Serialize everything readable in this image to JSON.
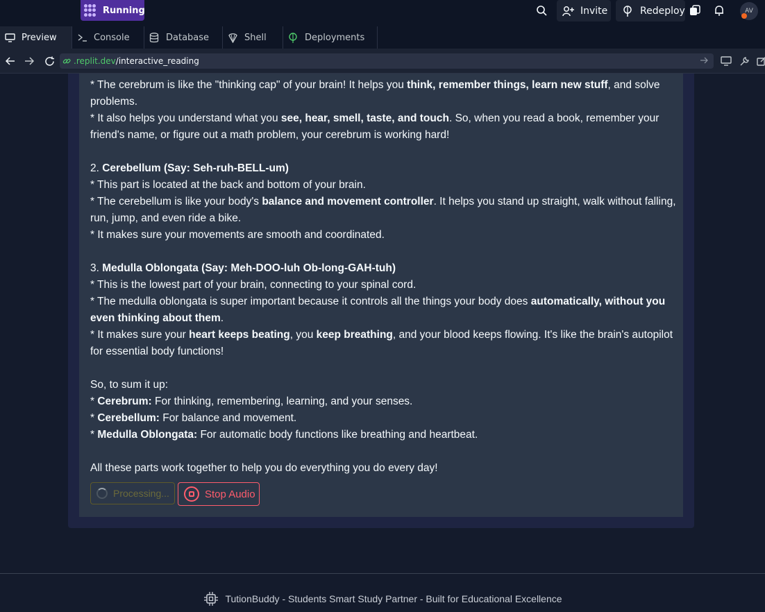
{
  "topbar": {
    "status_label": "Running",
    "invite_label": "Invite",
    "redeploy_label": "Redeploy",
    "avatar_initials": "AV"
  },
  "tabs": [
    {
      "label": "Preview",
      "icon": "monitor-icon"
    },
    {
      "label": "Console",
      "icon": "terminal-icon"
    },
    {
      "label": "Database",
      "icon": "database-icon"
    },
    {
      "label": "Shell",
      "icon": "shell-icon"
    },
    {
      "label": "Deployments",
      "icon": "deployments-icon"
    }
  ],
  "addressbar": {
    "host": ".replit.dev",
    "path": "/interactive_reading"
  },
  "article": {
    "cerebrum_1_pre": "* The cerebrum is like the \"thinking cap\" of your brain! It helps you ",
    "cerebrum_1_b": "think, remember things, learn new stuff",
    "cerebrum_1_post": ", and solve problems.",
    "cerebrum_2_pre": "* It also helps you understand what you ",
    "cerebrum_2_b": "see, hear, smell, taste, and touch",
    "cerebrum_2_post": ". So, when you read a book, remember your friend's name, or figure out a math problem, your cerebrum is working hard!",
    "cerebellum_num": "2. ",
    "cerebellum_title": "Cerebellum (Say: Seh-ruh-BELL-um)",
    "cerebellum_1": "* This part is located at the back and bottom of your brain.",
    "cerebellum_2_pre": "* The cerebellum is like your body's ",
    "cerebellum_2_b": "balance and movement controller",
    "cerebellum_2_post": ". It helps you stand up straight, walk without falling, run, jump, and even ride a bike.",
    "cerebellum_3": "* It makes sure your movements are smooth and coordinated.",
    "medulla_num": "3. ",
    "medulla_title": "Medulla Oblongata (Say: Meh-DOO-luh Ob-long-GAH-tuh)",
    "medulla_1": "* This is the lowest part of your brain, connecting to your spinal cord.",
    "medulla_2_pre": "* The medulla oblongata is super important because it controls all the things your body does ",
    "medulla_2_b": "automatically, without you even thinking about them",
    "medulla_2_post": ".",
    "medulla_3_pre": "* It makes sure your ",
    "medulla_3_b1": "heart keeps beating",
    "medulla_3_mid": ", you ",
    "medulla_3_b2": "keep breathing",
    "medulla_3_post": ", and your blood keeps flowing. It's like the brain's autopilot for essential body functions!",
    "sum_intro": "So, to sum it up:",
    "sum_1_star": "* ",
    "sum_1_b": "Cerebrum:",
    "sum_1_post": " For thinking, remembering, learning, and your senses.",
    "sum_2_star": "* ",
    "sum_2_b": "Cerebellum:",
    "sum_2_post": " For balance and movement.",
    "sum_3_star": "* ",
    "sum_3_b": "Medulla Oblongata:",
    "sum_3_post": " For automatic body functions like breathing and heartbeat.",
    "closing": "All these parts work together to help you do everything you do every day!"
  },
  "controls": {
    "processing_label": "Processing...",
    "stop_audio_label": "Stop Audio"
  },
  "footer": {
    "text": "TutionBuddy - Students Smart Study Partner - Built for Educational Excellence"
  },
  "colors": {
    "accent_running": "#502f9e",
    "url_host": "#4fc96a",
    "stop_red": "#ff5c6c"
  }
}
